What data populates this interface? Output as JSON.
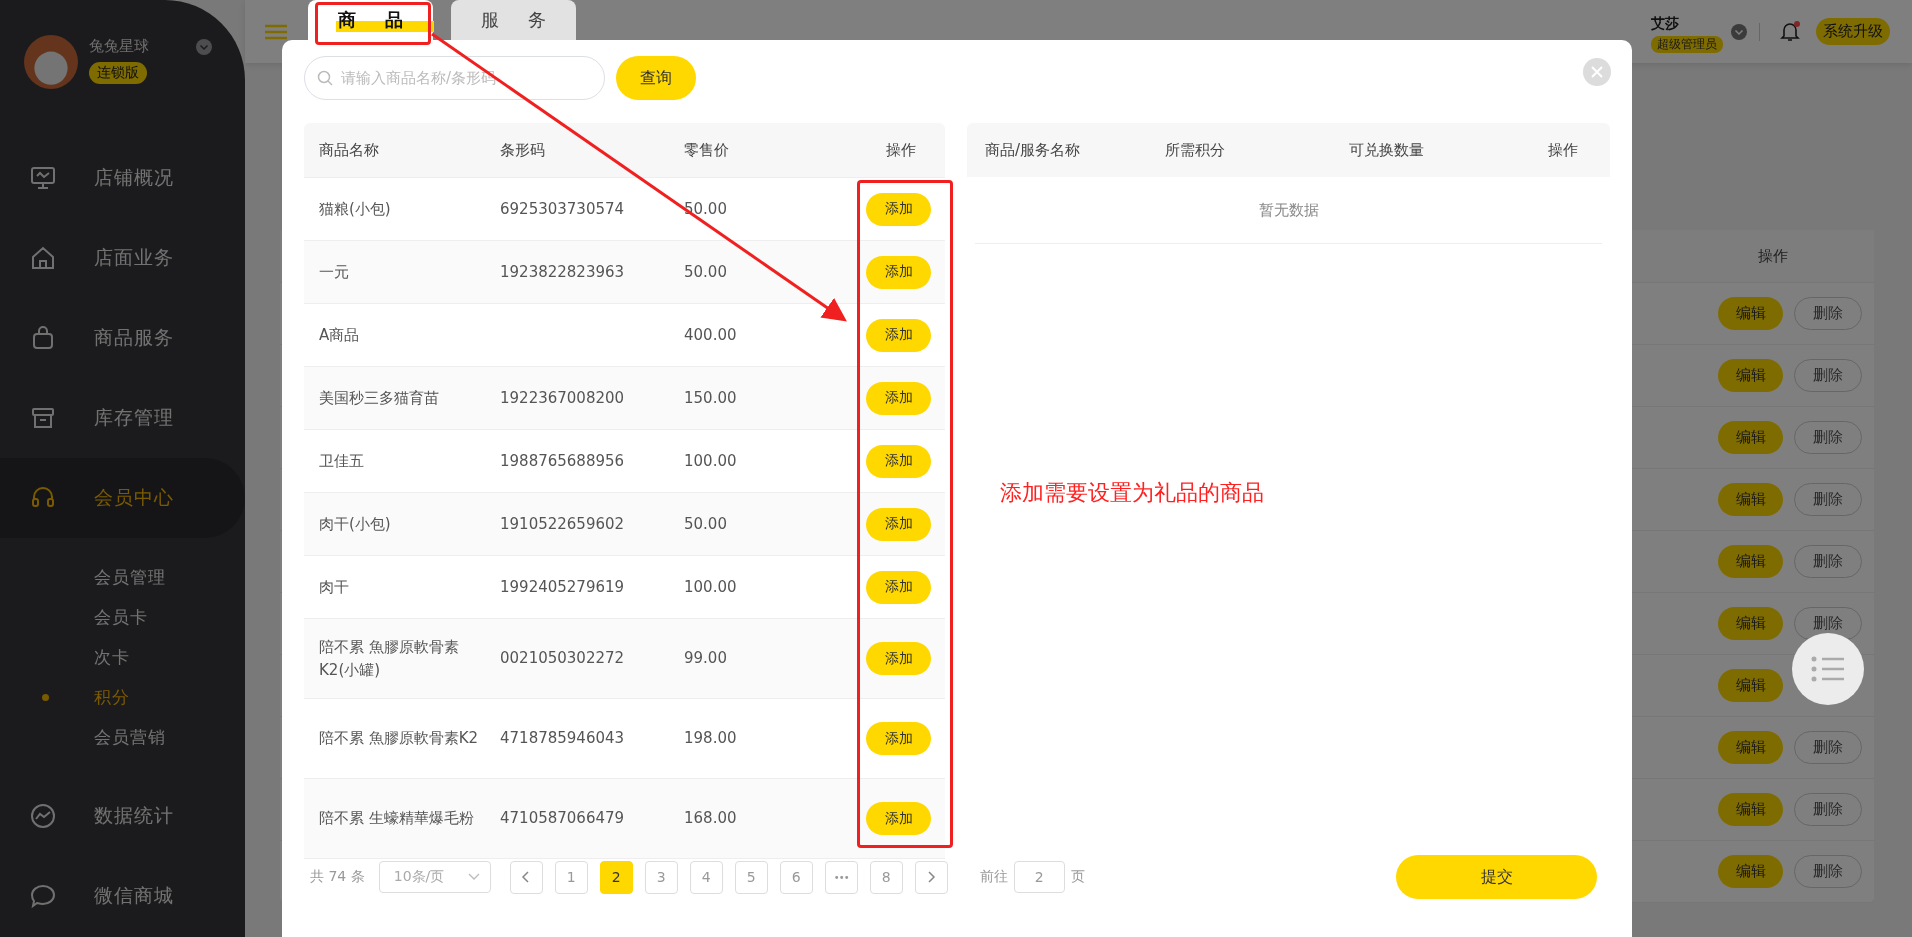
{
  "sidebar": {
    "store_name": "兔兔星球",
    "edition_badge": "连锁版",
    "items": [
      {
        "label": "店铺概况",
        "selected": false
      },
      {
        "label": "店面业务",
        "selected": false
      },
      {
        "label": "商品服务",
        "selected": false
      },
      {
        "label": "库存管理",
        "selected": false
      },
      {
        "label": "会员中心",
        "selected": true,
        "children": [
          {
            "label": "会员管理",
            "selected": false
          },
          {
            "label": "会员卡",
            "selected": false
          },
          {
            "label": "次卡",
            "selected": false
          },
          {
            "label": "积分",
            "selected": true
          },
          {
            "label": "会员营销",
            "selected": false
          }
        ]
      },
      {
        "label": "数据统计",
        "selected": false
      },
      {
        "label": "微信商城",
        "selected": false
      }
    ]
  },
  "header": {
    "user_name": "艾莎",
    "role_badge": "超级管理员",
    "notification_unread": true,
    "upgrade_button": "系统升级"
  },
  "background_table": {
    "columns": [
      "操作"
    ],
    "rows": [
      {
        "edit": "编辑",
        "delete": "删除"
      },
      {
        "edit": "编辑",
        "delete": "删除"
      },
      {
        "edit": "编辑",
        "delete": "删除"
      },
      {
        "edit": "编辑",
        "delete": "删除"
      },
      {
        "edit": "编辑",
        "delete": "删除"
      },
      {
        "edit": "编辑",
        "delete": "删除"
      },
      {
        "edit": "编辑"
      },
      {
        "edit": "编辑",
        "delete": "删除"
      },
      {
        "edit": "编辑",
        "delete": "删除"
      },
      {
        "edit": "编辑",
        "delete": "删除"
      }
    ]
  },
  "dialog": {
    "tabs": [
      {
        "label": "商品",
        "selected": true
      },
      {
        "label": "服务",
        "selected": false
      }
    ],
    "search": {
      "placeholder": "请输入商品名称/条形码"
    },
    "search_button": "查询",
    "products": {
      "columns": [
        "商品名称",
        "条形码",
        "零售价",
        "操作"
      ],
      "rows": [
        {
          "name": "猫粮(小包)",
          "barcode": "6925303730574",
          "price": "50.00",
          "action": "添加"
        },
        {
          "name": "一元",
          "barcode": "1923822823963",
          "price": "50.00",
          "action": "添加"
        },
        {
          "name": "A商品",
          "price": "400.00",
          "action": "添加"
        },
        {
          "name": "美国秒三多猫育苗",
          "barcode": "1922367008200",
          "price": "150.00",
          "action": "添加"
        },
        {
          "name": "卫佳五",
          "barcode": "1988765688956",
          "price": "100.00",
          "action": "添加"
        },
        {
          "name": "肉干(小包)",
          "barcode": "1910522659602",
          "price": "50.00",
          "action": "添加"
        },
        {
          "name": "肉干",
          "barcode": "1992405279619",
          "price": "100.00",
          "action": "添加"
        },
        {
          "name": "陪不累 魚膠原軟骨素K2(小罐)",
          "barcode": "0021050302272",
          "price": "99.00",
          "action": "添加"
        },
        {
          "name": "陪不累 魚膠原軟骨素K2",
          "barcode": "4718785946043",
          "price": "198.00",
          "action": "添加"
        },
        {
          "name": "陪不累 生蠔精華爆毛粉",
          "barcode": "4710587066479",
          "price": "168.00",
          "action": "添加"
        }
      ]
    },
    "chosen": {
      "columns": [
        "商品/服务名称",
        "所需积分",
        "可兑换数量",
        "操作"
      ],
      "empty_text": "暂无数据"
    },
    "pagination": {
      "total": "共 74 条",
      "page_size": "10条/页",
      "pages": [
        {
          "label": "1",
          "kind": "page",
          "selected": false
        },
        {
          "label": "2",
          "kind": "page",
          "selected": true
        },
        {
          "label": "3",
          "kind": "page",
          "selected": false
        },
        {
          "label": "4",
          "kind": "page",
          "selected": false
        },
        {
          "label": "5",
          "kind": "page",
          "selected": false
        },
        {
          "label": "6",
          "kind": "page",
          "selected": false
        },
        {
          "label": "•••",
          "kind": "ellipsis",
          "selected": false
        },
        {
          "label": "8",
          "kind": "page",
          "selected": false
        }
      ],
      "goto_label": "前往",
      "goto_value": "2",
      "goto_suffix": "页"
    },
    "submit_button": "提交"
  },
  "annotation": {
    "note": "添加需要设置为礼品的商品"
  }
}
